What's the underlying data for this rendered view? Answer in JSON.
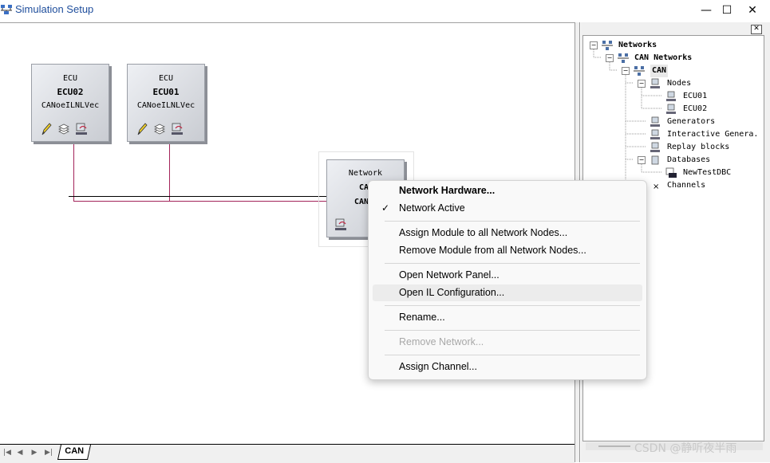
{
  "window": {
    "title": "Simulation Setup",
    "controls": {
      "minimize": "—",
      "maximize": "☐",
      "close": "✕"
    }
  },
  "canvas": {
    "ecus": [
      {
        "type": "ECU",
        "name": "ECU02",
        "module": "CANoeILNLVec"
      },
      {
        "type": "ECU",
        "name": "ECU01",
        "module": "CANoeILNLVec"
      }
    ],
    "network_box": {
      "type": "Network",
      "name": "CA",
      "module": "CAN"
    }
  },
  "tabs": {
    "nav": [
      "|◀",
      "◀",
      "▶",
      "▶|"
    ],
    "active": "CAN"
  },
  "tree": {
    "close": "✕",
    "items": [
      {
        "label": "Networks",
        "expander": "−",
        "icon": "network-icon"
      },
      {
        "label": "CAN Networks",
        "expander": "−",
        "icon": "network-icon"
      },
      {
        "label": "CAN",
        "expander": "−",
        "icon": "network-icon"
      },
      {
        "label": "Nodes",
        "expander": "−",
        "icon": "computer-icon"
      },
      {
        "label": "ECU01",
        "icon": "computer-icon"
      },
      {
        "label": "ECU02",
        "icon": "computer-icon"
      },
      {
        "label": "Generators",
        "icon": "computer-icon"
      },
      {
        "label": "Interactive Genera.",
        "icon": "computer-icon"
      },
      {
        "label": "Replay blocks",
        "icon": "computer-icon"
      },
      {
        "label": "Databases",
        "expander": "−",
        "icon": "database-icon"
      },
      {
        "label": "NewTestDBC",
        "icon": "dbc-icon"
      },
      {
        "label": "Channels",
        "icon": "channel-icon"
      }
    ]
  },
  "context_menu": {
    "items": [
      {
        "label": "Network Hardware...",
        "bold": true
      },
      {
        "label": "Network Active",
        "checked": true,
        "check_mark": "✓"
      },
      {
        "label": "Assign Module to all Network Nodes..."
      },
      {
        "label": "Remove Module from all Network Nodes..."
      },
      {
        "label": "Open Network Panel..."
      },
      {
        "label": "Open IL Configuration..."
      },
      {
        "label": "Rename..."
      },
      {
        "label": "Remove Network...",
        "disabled": true
      },
      {
        "label": "Assign Channel..."
      }
    ]
  },
  "watermark": "CSDN @静听夜半雨",
  "colors": {
    "title_text": "#1f4e9c",
    "bus_red": "#a3245a",
    "bus_black": "#000000",
    "disabled_text": "#a8a8a8"
  }
}
